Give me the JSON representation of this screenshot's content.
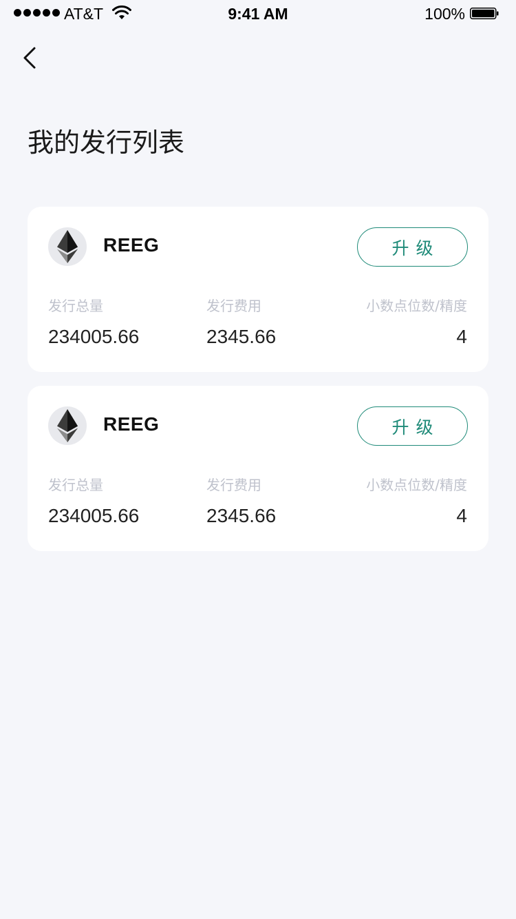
{
  "status_bar": {
    "carrier": "AT&T",
    "time": "9:41 AM",
    "battery": "100%"
  },
  "page": {
    "title": "我的发行列表"
  },
  "labels": {
    "total_issued": "发行总量",
    "issue_fee": "发行费用",
    "decimals": "小数点位数/精度"
  },
  "tokens": [
    {
      "name": "REEG",
      "icon": "ethereum-icon",
      "upgrade_label": "升级",
      "total_issued": "234005.66",
      "issue_fee": "2345.66",
      "decimals": "4"
    },
    {
      "name": "REEG",
      "icon": "ethereum-icon",
      "upgrade_label": "升级",
      "total_issued": "234005.66",
      "issue_fee": "2345.66",
      "decimals": "4"
    }
  ],
  "colors": {
    "accent": "#1E8A78",
    "background": "#F5F6FA",
    "muted_label": "#BFC2CC"
  }
}
